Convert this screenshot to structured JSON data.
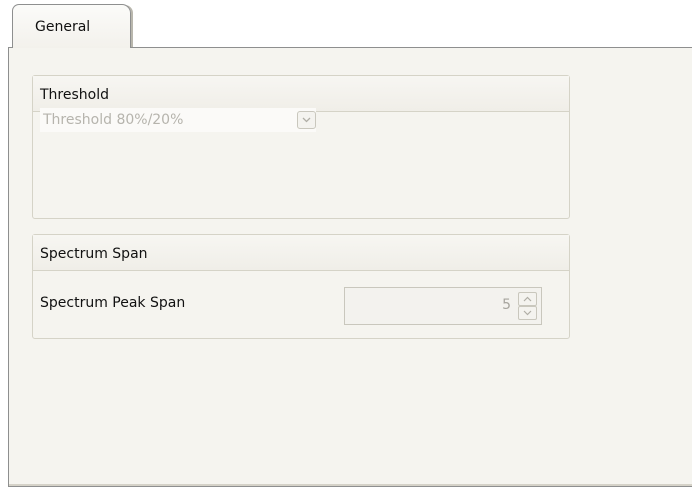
{
  "tabs": [
    {
      "label": "General",
      "active": true
    }
  ],
  "threshold_group": {
    "title": "Threshold",
    "combo": {
      "selected": "Threshold 80%/20%",
      "enabled": false
    }
  },
  "span_group": {
    "title": "Spectrum Span",
    "peak_span": {
      "label": "Spectrum Peak Span",
      "value": "5",
      "enabled": false
    }
  },
  "icons": {
    "combo_button": "chevron-down-icon",
    "spin_up": "arrow-up-icon",
    "spin_down": "arrow-down-icon"
  },
  "colors": {
    "panel_bg": "#f5f4ef",
    "border": "#8e8f8f",
    "disabled_text": "#b6b4ad"
  }
}
